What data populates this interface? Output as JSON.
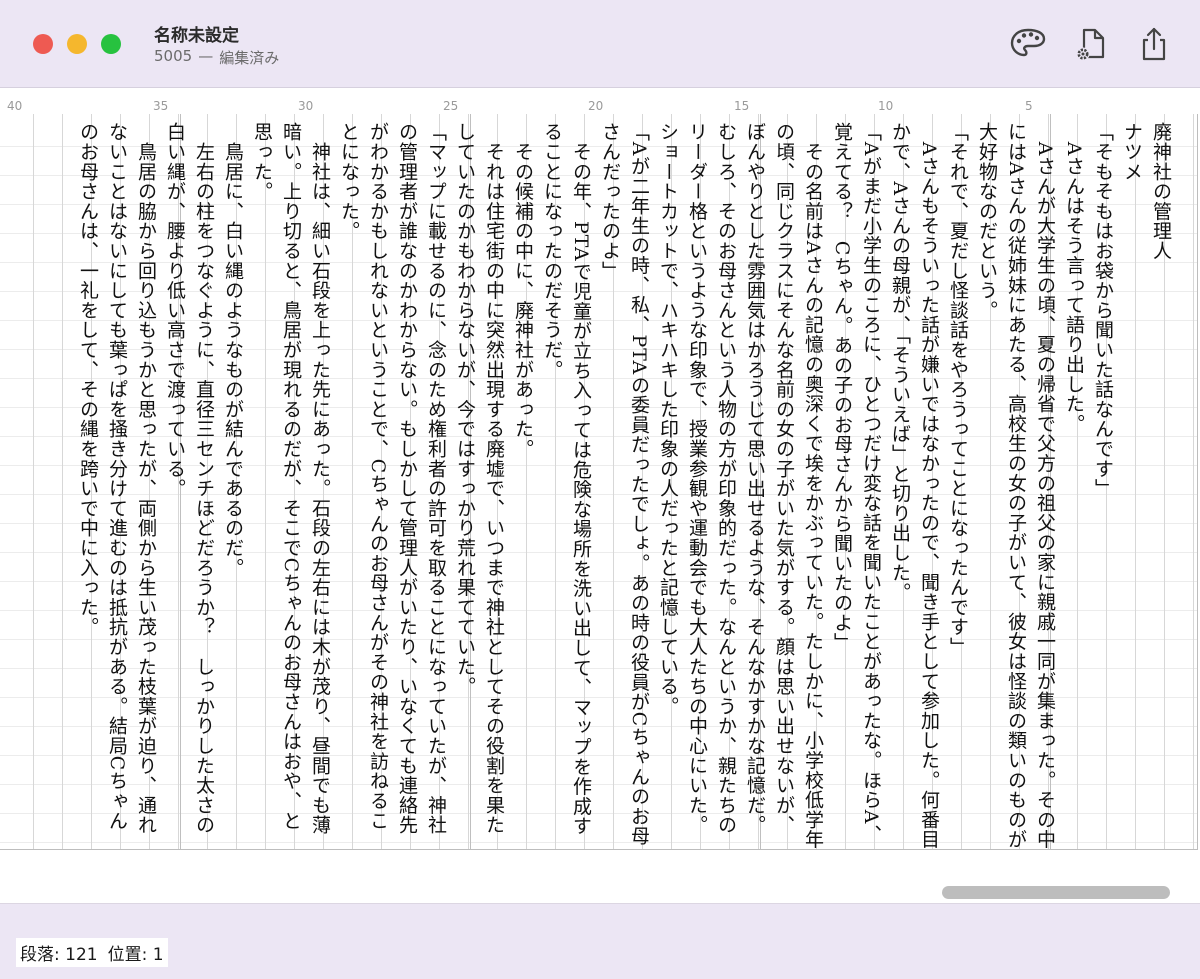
{
  "window": {
    "title": "名称未設定",
    "word_count": "5005",
    "separator": "—",
    "edit_state": "編集済み"
  },
  "toolbar": {
    "icons": [
      "palette-icon",
      "document-settings-icon",
      "share-icon"
    ]
  },
  "ruler": {
    "marks": [
      "40",
      "35",
      "30",
      "25",
      "20",
      "15",
      "10",
      "5"
    ]
  },
  "document": {
    "paragraphs": [
      "廃神社の管理人",
      "ナツメ",
      "「そもそもはお袋から聞いた話なんです」",
      "　Aさんはそう言って語り出した。",
      "　Aさんが大学生の頃、夏の帰省で父方の祖父の家に親戚一同が集まった。その中にはAさんの従姉妹にあたる、高校生の女の子がいて、彼女は怪談の類いのものが大好物なのだという。",
      "「それで、夏だし怪談話をやろうってことになったんです」",
      "　Aさんもそういった話が嫌いではなかったので、聞き手として参加した。何番目かで、Aさんの母親が、「そういえば」と切り出した。",
      "「Aがまだ小学生のころに、ひとつだけ変な話を聞いたことがあったな。ほらA、覚えてる？　Cちゃん。あの子のお母さんから聞いたのよ」",
      "　その名前はAさんの記憶の奥深くで埃をかぶっていた。たしかに、小学校低学年の頃、同じクラスにそんな名前の女の子がいた気がする。顔は思い出せないが、ぼんやりとした雰囲気はかろうじて思い出せるような、そんなかすかな記憶だ。むしろ、そのお母さんという人物の方が印象的だった。なんというか、親たちのリーダー格というような印象で、授業参観や運動会でも大人たちの中心にいた。ショートカットで、ハキハキした印象の人だったと記憶している。",
      "「Aが二年生の時、私、PTAの委員だったでしょ。あの時の役員がCちゃんのお母さんだったのよ」",
      "　その年、PTAで児童が立ち入っては危険な場所を洗い出して、マップを作成することになったのだそうだ。",
      "　その候補の中に、廃神社があった。",
      "　それは住宅街の中に突然出現する廃墟で、いつまで神社としてその役割を果たしていたのかもわからないが、今ではすっかり荒れ果てていた。",
      "「マップに載せるのに、念のため権利者の許可を取ることになっていたが、神社の管理者が誰なのかわからない。もしかして管理人がいたり、いなくても連絡先がわかるかもしれないということで、Cちゃんのお母さんがその神社を訪ねることになった。",
      "　神社は、細い石段を上った先にあった。石段の左右には木が茂り、昼間でも薄暗い。上り切ると、鳥居が現れるのだが、そこでCちゃんのお母さんはおや、と思った。",
      "　鳥居に、白い縄のようなものが結んであるのだ。",
      "　左右の柱をつなぐように、直径三センチほどだろうか？　しっかりした太さの白い縄が、腰より低い高さで渡っている。",
      "　鳥居の脇から回り込もうかと思ったが、両側から生い茂った枝葉が迫り、通れないことはないにしても葉っぱを掻き分けて進むのは抵抗がある。結局Cちゃんのお母さんは、一礼をして、その縄を跨いで中に入った。"
    ]
  },
  "status": {
    "paragraph_label": "段落:",
    "paragraph_value": "121",
    "position_label": "位置:",
    "position_value": "1"
  }
}
